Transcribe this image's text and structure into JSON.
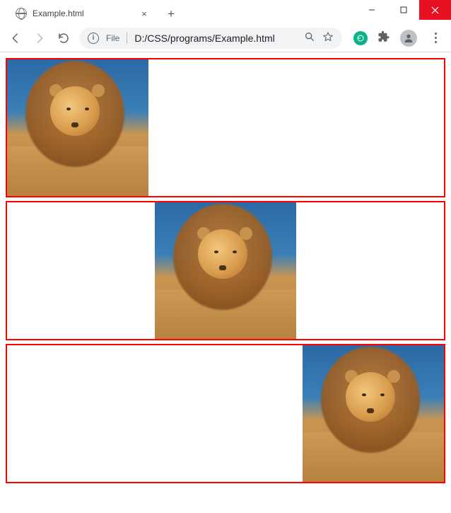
{
  "window": {
    "minimize": "–",
    "maximize": "□",
    "close": "×"
  },
  "tab": {
    "title": "Example.html",
    "close": "×",
    "new_tab": "+"
  },
  "toolbar": {
    "scheme": "File",
    "url": "D:/CSS/programs/Example.html",
    "info_glyph": "i"
  },
  "content": {
    "boxes": [
      {
        "align": "left",
        "image_name": "lion-image"
      },
      {
        "align": "center",
        "image_name": "lion-image"
      },
      {
        "align": "right",
        "image_name": "lion-image"
      }
    ]
  }
}
